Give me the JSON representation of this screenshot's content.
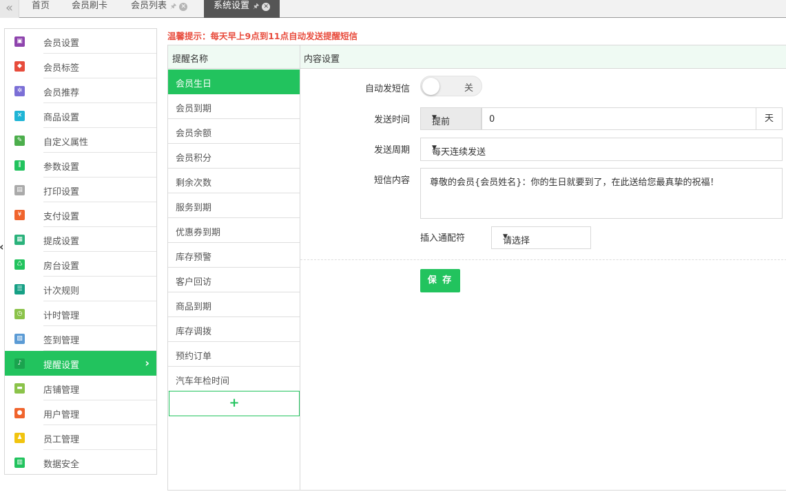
{
  "tabs": [
    {
      "label": "首页",
      "pinned": false,
      "closable": false,
      "active": false
    },
    {
      "label": "会员刷卡",
      "pinned": false,
      "closable": false,
      "active": false
    },
    {
      "label": "会员列表",
      "pinned": true,
      "closable": true,
      "active": false
    },
    {
      "label": "系统设置",
      "pinned": true,
      "closable": true,
      "active": true
    }
  ],
  "sidebar": {
    "items": [
      {
        "label": "会员设置",
        "icon": "member-settings-icon",
        "color": "#8e44ad"
      },
      {
        "label": "会员标签",
        "icon": "tag-icon",
        "color": "#e74c3c"
      },
      {
        "label": "会员推荐",
        "icon": "atom-icon",
        "color": "#7b6fd6"
      },
      {
        "label": "商品设置",
        "icon": "tools-icon",
        "color": "#1fb5d6"
      },
      {
        "label": "自定义属性",
        "icon": "pencil-icon",
        "color": "#4cae4c"
      },
      {
        "label": "参数设置",
        "icon": "sliders-icon",
        "color": "#22c35e"
      },
      {
        "label": "打印设置",
        "icon": "printer-icon",
        "color": "#aaaaaa"
      },
      {
        "label": "支付设置",
        "icon": "payment-icon",
        "color": "#f0642d"
      },
      {
        "label": "提成设置",
        "icon": "commission-icon",
        "color": "#2ab27b"
      },
      {
        "label": "房台设置",
        "icon": "recycle-icon",
        "color": "#22c35e"
      },
      {
        "label": "计次规则",
        "icon": "list-icon",
        "color": "#16a085"
      },
      {
        "label": "计时管理",
        "icon": "clock-icon",
        "color": "#8bc34a"
      },
      {
        "label": "签到管理",
        "icon": "calendar-icon",
        "color": "#5b9bd5"
      },
      {
        "label": "提醒设置",
        "icon": "bell-icon",
        "color": "#22c35e",
        "active": true
      },
      {
        "label": "店铺管理",
        "icon": "store-icon",
        "color": "#8bc34a"
      },
      {
        "label": "用户管理",
        "icon": "user-icon",
        "color": "#f0642d"
      },
      {
        "label": "员工管理",
        "icon": "staff-icon",
        "color": "#f1c40f"
      },
      {
        "label": "数据安全",
        "icon": "bar-chart-icon",
        "color": "#22c35e"
      }
    ]
  },
  "hint": "温馨提示：每天早上9点到11点自动发送提醒短信",
  "table": {
    "col_name": "提醒名称",
    "col_content": "内容设置"
  },
  "remind_list": [
    {
      "label": "会员生日",
      "active": true
    },
    {
      "label": "会员到期"
    },
    {
      "label": "会员余额"
    },
    {
      "label": "会员积分"
    },
    {
      "label": "剩余次数"
    },
    {
      "label": "服务到期"
    },
    {
      "label": "优惠券到期"
    },
    {
      "label": "库存预警"
    },
    {
      "label": "客户回访"
    },
    {
      "label": "商品到期"
    },
    {
      "label": "库存调拨"
    },
    {
      "label": "预约订单"
    },
    {
      "label": "汽车年检时间"
    }
  ],
  "add_label": "+",
  "form": {
    "auto_sms_label": "自动发短信",
    "auto_sms_state": "关",
    "send_time_label": "发送时间",
    "send_time_mode": "提前",
    "send_time_days": "0",
    "send_time_unit": "天",
    "cycle_label": "发送周期",
    "cycle_value": "每天连续发送",
    "content_label": "短信内容",
    "content_value": "尊敬的会员{会员姓名}：你的生日就要到了，在此送给您最真挚的祝福！",
    "wildcard_label": "插入通配符",
    "wildcard_value": "请选择",
    "save_label": "保 存"
  },
  "colors": {
    "accent": "#22c35e",
    "warning": "#e84c3d"
  }
}
